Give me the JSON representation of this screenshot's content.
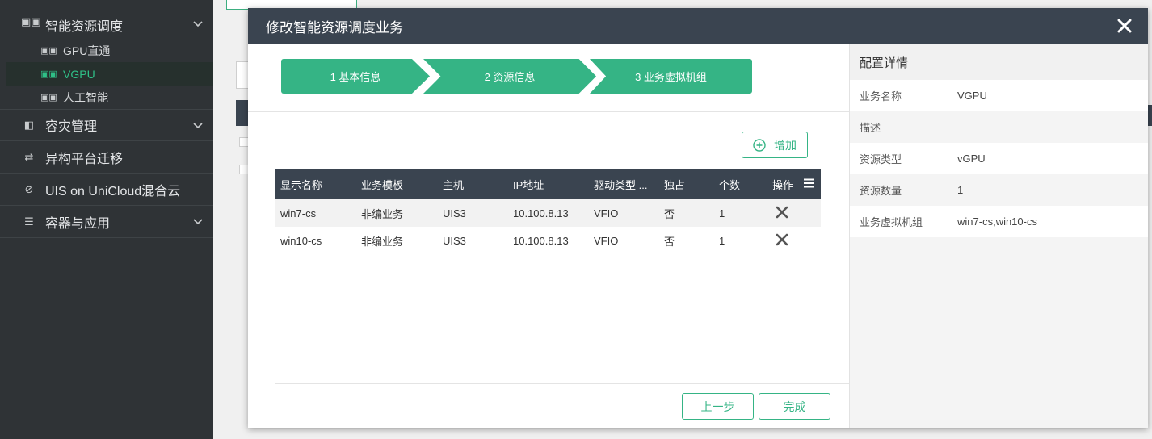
{
  "sidebar": {
    "items": [
      {
        "label": "智能资源调度"
      },
      {
        "label": "GPU直通"
      },
      {
        "label": "VGPU"
      },
      {
        "label": "人工智能"
      },
      {
        "label": "容灾管理"
      },
      {
        "label": "异构平台迁移"
      },
      {
        "label": "UIS on UniCloud混合云"
      },
      {
        "label": "容器与应用"
      }
    ]
  },
  "modal": {
    "title": "修改智能资源调度业务",
    "close_icon": "close-icon",
    "steps": [
      "1 基本信息",
      "2 资源信息",
      "3 业务虚拟机组"
    ],
    "add_label": "增加",
    "table": {
      "headers": [
        "显示名称",
        "业务模板",
        "主机",
        "IP地址",
        "驱动类型 ...",
        "独占",
        "个数",
        "操作"
      ],
      "rows": [
        {
          "name": "win7-cs",
          "template": "非编业务",
          "host": "UIS3",
          "ip": "10.100.8.13",
          "driver": "VFIO",
          "exclusive": "否",
          "count": "1"
        },
        {
          "name": "win10-cs",
          "template": "非编业务",
          "host": "UIS3",
          "ip": "10.100.8.13",
          "driver": "VFIO",
          "exclusive": "否",
          "count": "1"
        }
      ]
    },
    "prev_label": "上一步",
    "done_label": "完成"
  },
  "details": {
    "title": "配置详情",
    "rows": [
      {
        "key": "业务名称",
        "value": "VGPU"
      },
      {
        "key": "描述",
        "value": ""
      },
      {
        "key": "资源类型",
        "value": "vGPU"
      },
      {
        "key": "资源数量",
        "value": "1"
      },
      {
        "key": "业务虚拟机组",
        "value": "win7-cs,win10-cs"
      }
    ]
  },
  "colors": {
    "accent": "#35b485",
    "header_dark": "#3a4450",
    "sidebar_bg": "#2f3336"
  }
}
